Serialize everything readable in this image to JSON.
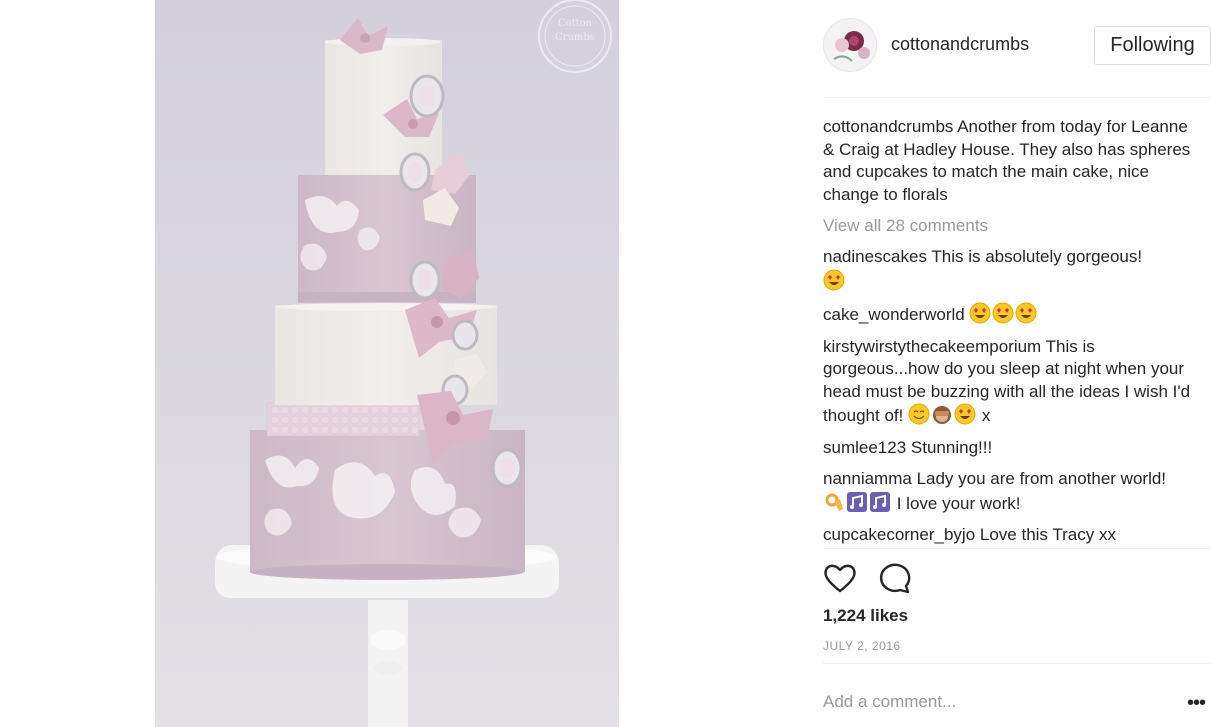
{
  "post": {
    "username": "cottonandcrumbs",
    "follow_label": "Following",
    "caption": {
      "user": "cottonandcrumbs",
      "text": "Another from today for Leanne & Craig at Hadley House. They also has spheres and cupcakes to match the main cake, nice change to florals"
    },
    "view_all_label": "View all 28 comments",
    "comments": [
      {
        "user": "nadinescakes",
        "text": "This is absolutely gorgeous!",
        "emoji": [
          "heart-eyes"
        ]
      },
      {
        "user": "cake_wonderworld",
        "text": "",
        "emoji": [
          "heart-eyes",
          "heart-eyes",
          "heart-eyes"
        ]
      },
      {
        "user": "kirstywirstythecakeemporium",
        "text": "This is gorgeous...how do you sleep at night when your head must be buzzing with all the ideas I wish I'd thought of!",
        "emoji": [
          "smiling-face",
          "see-no-evil-monkey",
          "heart-eyes"
        ],
        "suffix": "x"
      },
      {
        "user": "sumlee123",
        "text": "Stunning!!!",
        "emoji": []
      },
      {
        "user": "nanniamma",
        "text": "Lady you are from another world!",
        "emoji": [
          "ok-hand",
          "musical-notes",
          "musical-notes"
        ],
        "suffix": "I love your work!"
      },
      {
        "user": "cupcakecorner_byjo",
        "text": "Love this Tracy xx",
        "emoji": []
      }
    ],
    "likes_label": "1,224 likes",
    "date_label": "JULY 2, 2016",
    "add_comment_placeholder": "Add a comment...",
    "more_label": "•••",
    "icons": {
      "like": "heart-outline-icon",
      "comment": "speech-bubble-icon",
      "more": "ellipsis-icon"
    },
    "watermark": "Cotton Crumbs"
  },
  "colors": {
    "text": "#262626",
    "muted": "#999999",
    "border": "#dbdbdb",
    "divider": "#efefef"
  }
}
